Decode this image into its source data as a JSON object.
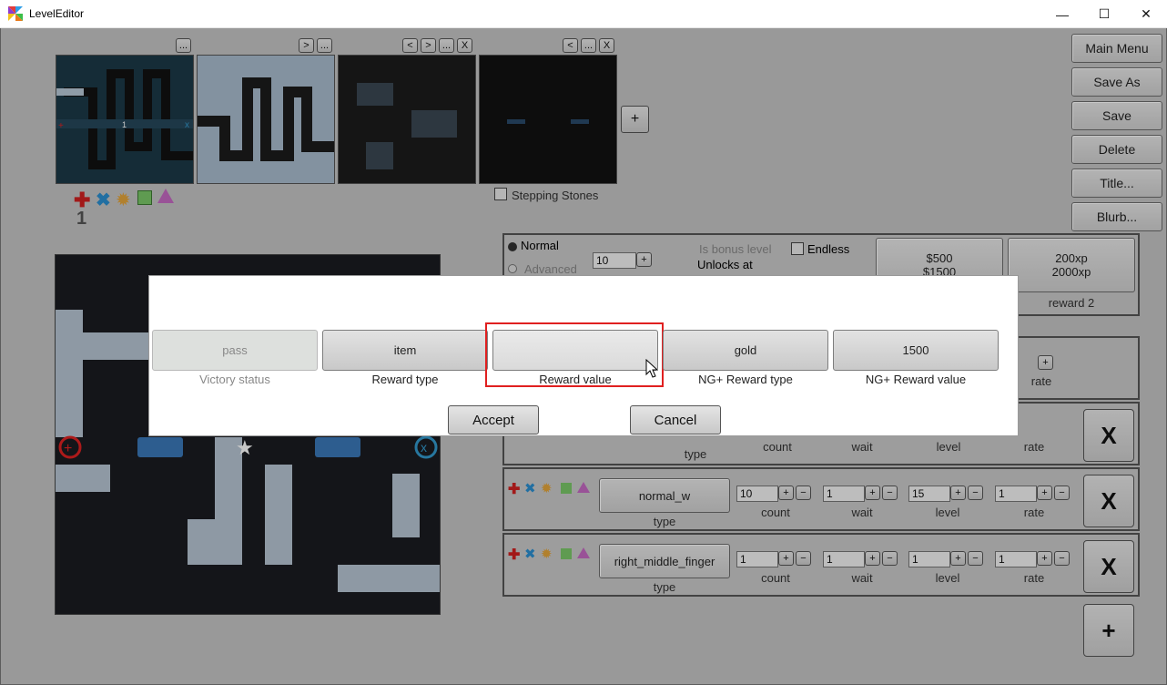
{
  "window": {
    "title": "LevelEditor"
  },
  "right_menu": [
    "Main Menu",
    "Save As",
    "Save",
    "Delete",
    "Title...",
    "Blurb..."
  ],
  "thumb_buttons": {
    "more": "...",
    "left": "<",
    "right": ">",
    "close": "X",
    "add": "+"
  },
  "stepping_stones": "Stepping Stones",
  "markers": {
    "start_number": "1"
  },
  "level_settings": {
    "mode_normal": "Normal",
    "mode_advanced": "Advanced",
    "count_value": "10",
    "bonus_label": "Is bonus level",
    "unlocks_label": "Unlocks at",
    "endless_label": "Endless",
    "reward1_line1": "$500",
    "reward1_line2": "$1500",
    "reward2_line1": "200xp",
    "reward2_line2": "2000xp",
    "reward2_caption": "reward 2"
  },
  "wave_labels": {
    "type": "type",
    "count": "count",
    "wait": "wait",
    "level": "level",
    "rate": "rate",
    "remove": "X",
    "add": "+"
  },
  "waves": [
    {
      "type": "normal_w",
      "count": "10",
      "wait": "1",
      "level": "15",
      "rate": "1"
    },
    {
      "type": "right_middle_finger",
      "count": "1",
      "wait": "1",
      "level": "1",
      "rate": "1"
    }
  ],
  "dialog": {
    "fields": [
      {
        "value": "pass",
        "label": "Victory status"
      },
      {
        "value": "item",
        "label": "Reward type"
      },
      {
        "value": "",
        "label": "Reward value"
      },
      {
        "value": "gold",
        "label": "NG+ Reward type"
      },
      {
        "value": "1500",
        "label": "NG+ Reward value"
      }
    ],
    "accept": "Accept",
    "cancel": "Cancel"
  }
}
